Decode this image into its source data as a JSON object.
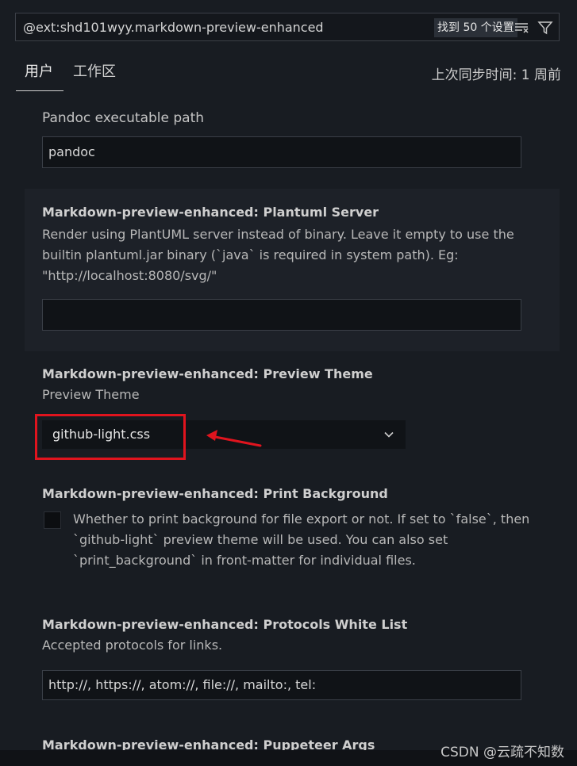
{
  "search": {
    "query": "@ext:shd101wyy.markdown-preview-enhanced",
    "result_count": "找到 50 个设置",
    "icons": [
      "clear-filter-icon",
      "filter-icon"
    ]
  },
  "tabs": [
    {
      "label": "用户",
      "active": true
    },
    {
      "label": "工作区",
      "active": false
    }
  ],
  "sync_status": "上次同步时间: 1 周前",
  "settings": {
    "pandoc": {
      "title": "Pandoc executable path",
      "value": "pandoc"
    },
    "plantuml": {
      "title": "Markdown-preview-enhanced: Plantuml Server",
      "description": "Render using PlantUML server instead of binary. Leave it empty to use the builtin plantuml.jar binary (`java` is required in system path). Eg: \"http://localhost:8080/svg/\"",
      "value": ""
    },
    "preview_theme": {
      "title": "Markdown-preview-enhanced: Preview Theme",
      "description": "Preview Theme",
      "value": "github-light.css"
    },
    "print_background": {
      "title": "Markdown-preview-enhanced: Print Background",
      "description": "Whether to print background for file export or not. If set to `false`, then `github-light` preview theme will be used. You can also set `print_background` in front-matter for individual files.",
      "checked": false
    },
    "protocols": {
      "title": "Markdown-preview-enhanced: Protocols White List",
      "description": "Accepted protocols for links.",
      "value": "http://, https://, atom://, file://, mailto:, tel:"
    },
    "puppeteer": {
      "title": "Markdown-preview-enhanced: Puppeteer Args"
    }
  },
  "annotation": {
    "color": "#e0141e"
  },
  "watermark": "CSDN @云疏不知数"
}
